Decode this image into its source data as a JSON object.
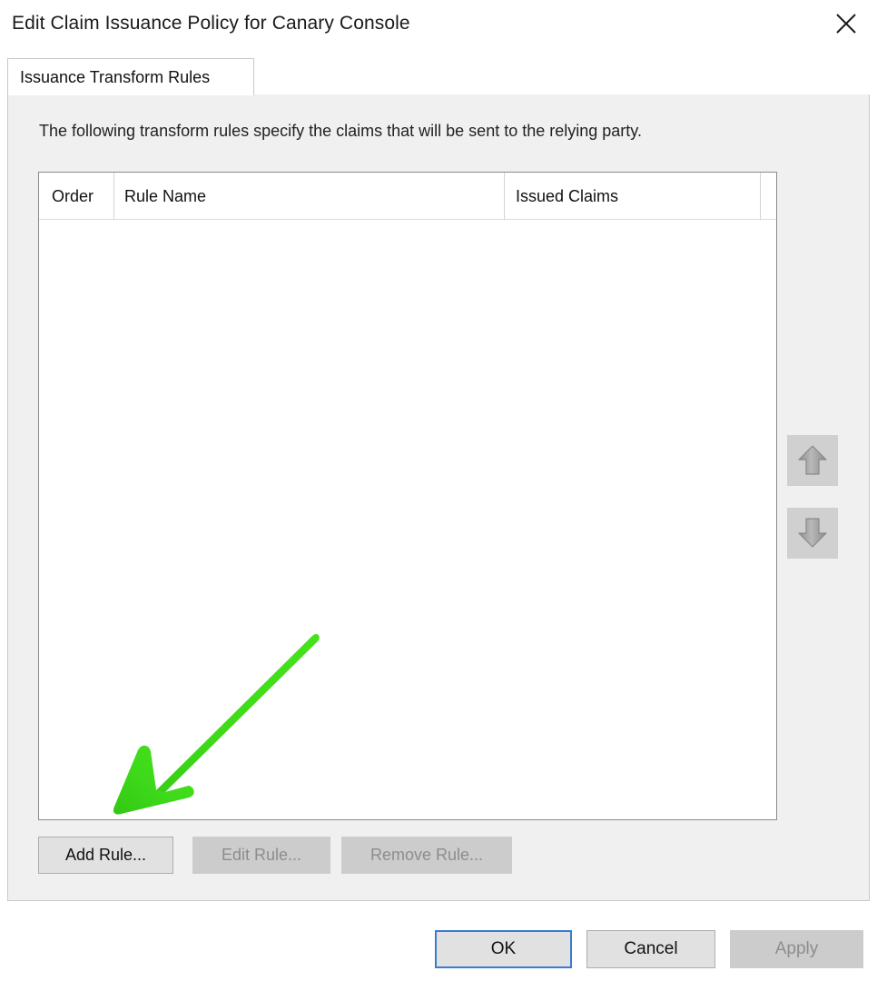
{
  "window": {
    "title": "Edit Claim Issuance Policy for Canary Console",
    "close_icon": "close-icon"
  },
  "tabs": [
    {
      "label": "Issuance Transform Rules",
      "active": true
    }
  ],
  "main": {
    "description": "The following transform rules specify the claims that will be sent to the relying party.",
    "list": {
      "columns": [
        {
          "label": "Order"
        },
        {
          "label": "Rule Name"
        },
        {
          "label": "Issued Claims"
        }
      ],
      "rows": []
    },
    "reorder_buttons": [
      {
        "icon": "arrow-up-icon",
        "enabled": false
      },
      {
        "icon": "arrow-down-icon",
        "enabled": false
      }
    ],
    "rule_buttons": [
      {
        "label": "Add Rule...",
        "enabled": true
      },
      {
        "label": "Edit Rule...",
        "enabled": false
      },
      {
        "label": "Remove Rule...",
        "enabled": false
      }
    ]
  },
  "footer": {
    "ok_label": "OK",
    "cancel_label": "Cancel",
    "apply_label": "Apply"
  },
  "annotation": {
    "type": "arrow",
    "color": "#3ed91a",
    "points_to": "add-rule-button"
  },
  "colors": {
    "panel_background": "#f0f0f0",
    "list_background": "#ffffff",
    "accent_focus_border": "#3a7cd0",
    "disabled_text": "#8d8d8d",
    "annotation_green": "#3ed91a"
  }
}
